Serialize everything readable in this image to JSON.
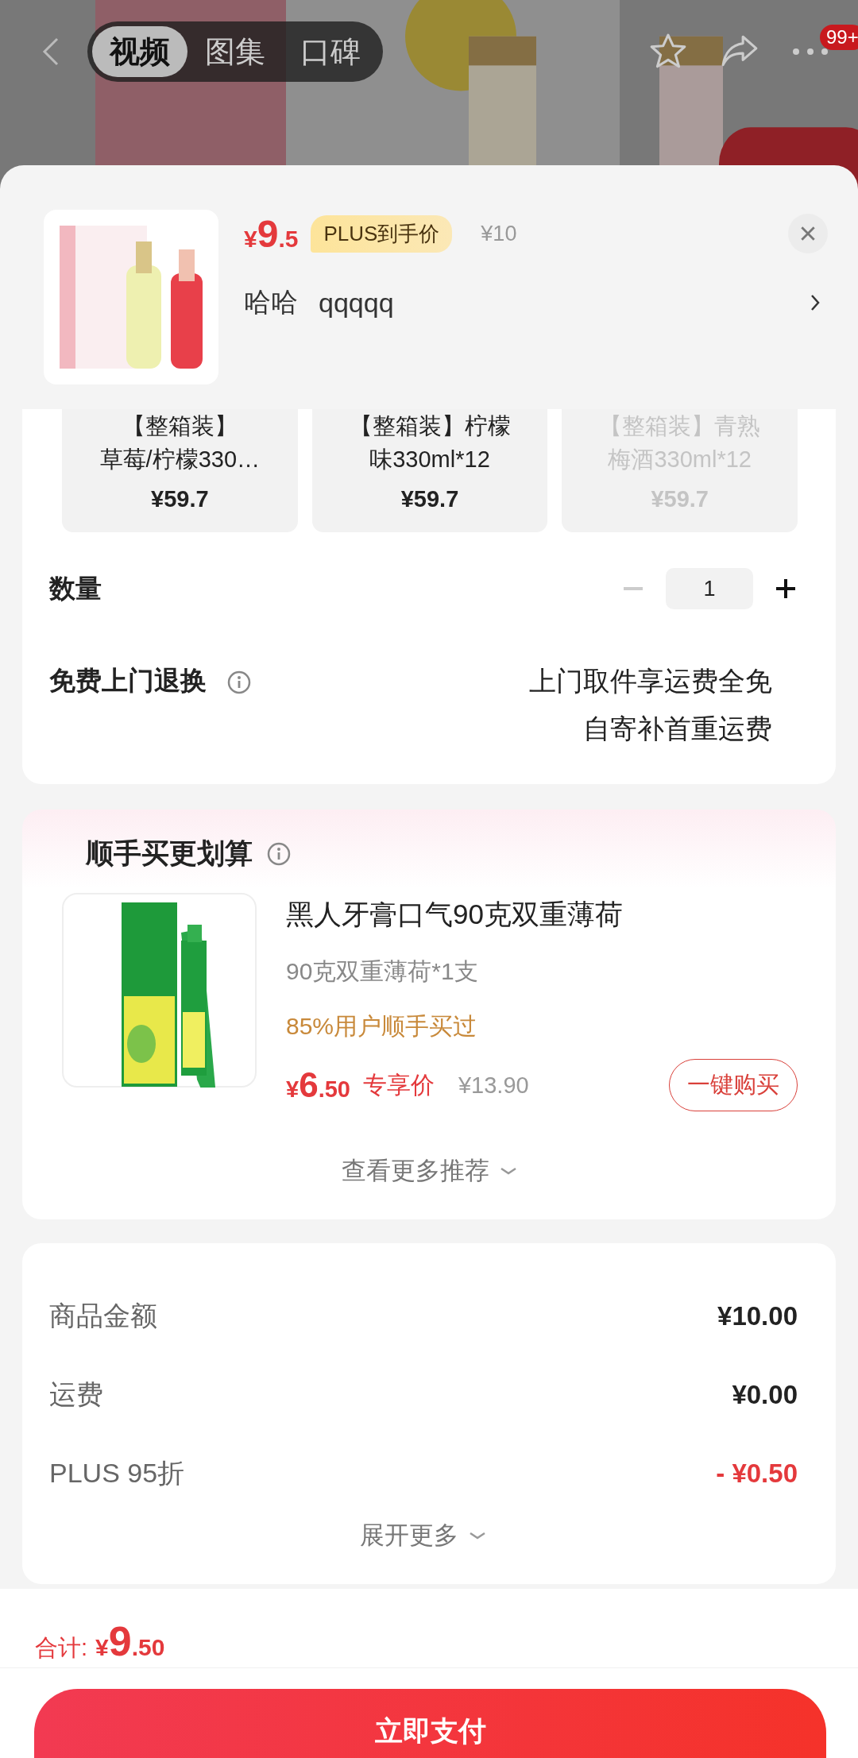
{
  "top_bar": {
    "tabs": [
      {
        "label": "视频",
        "selected": true
      },
      {
        "label": "图集",
        "selected": false
      },
      {
        "label": "口碑",
        "selected": false
      }
    ],
    "badge": "99+"
  },
  "product": {
    "price": {
      "currency": "¥",
      "integer": "9",
      "decimal": ".5"
    },
    "price_tag": "PLUS到手价",
    "original_price": "¥10",
    "spec": [
      "哈哈",
      "qqqqq"
    ]
  },
  "variants": [
    {
      "lines": [
        "【整箱装】",
        "草莓/柠檬330…"
      ],
      "price": "¥59.7",
      "disabled": false
    },
    {
      "lines": [
        "【整箱装】柠檬",
        "味330ml*12"
      ],
      "price": "¥59.7",
      "disabled": false
    },
    {
      "lines": [
        "【整箱装】青熟",
        "梅酒330ml*12"
      ],
      "price": "¥59.7",
      "disabled": true
    }
  ],
  "quantity": {
    "label": "数量",
    "value": "1",
    "minus_disabled": true
  },
  "return_service": {
    "label": "免费上门退换",
    "lines": [
      "上门取件享运费全免",
      "自寄补首重运费"
    ]
  },
  "add_on": {
    "title": "顺手买更划算",
    "item": {
      "name": "黑人牙膏口气90克双重薄荷",
      "spec": "90克双重薄荷*1支",
      "social_proof": "85%用户顺手买过",
      "price": {
        "currency": "¥",
        "integer": "6",
        "decimal": ".50"
      },
      "price_label": "专享价",
      "original_price": "¥13.90",
      "button": "一键购买"
    },
    "more": "查看更多推荐"
  },
  "summary": {
    "rows": [
      {
        "label": "商品金额",
        "value": "¥10.00",
        "kind": "normal"
      },
      {
        "label": "运费",
        "value": "¥0.00",
        "kind": "normal"
      },
      {
        "label": "PLUS 95折",
        "value": "- ¥0.50",
        "kind": "discount"
      }
    ],
    "expand": "展开更多"
  },
  "footer": {
    "total_label": "合计:",
    "total": {
      "currency": "¥",
      "integer": "9",
      "decimal": ".50"
    },
    "pay_button": "立即支付"
  }
}
